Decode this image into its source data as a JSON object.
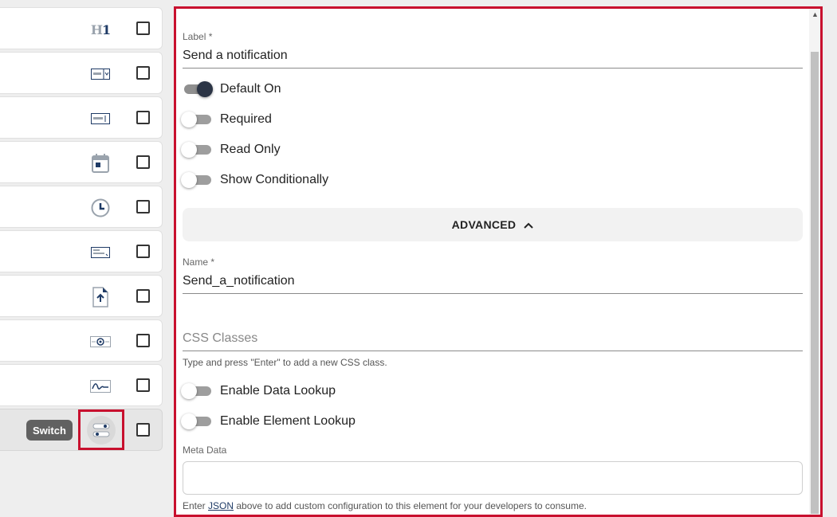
{
  "element_types": [
    {
      "name": "heading",
      "icon": "heading-icon"
    },
    {
      "name": "select",
      "icon": "select-dropdown-icon"
    },
    {
      "name": "text-input",
      "icon": "text-input-icon"
    },
    {
      "name": "date",
      "icon": "calendar-icon"
    },
    {
      "name": "time",
      "icon": "clock-icon"
    },
    {
      "name": "textarea",
      "icon": "textarea-icon"
    },
    {
      "name": "file-upload",
      "icon": "file-upload-icon"
    },
    {
      "name": "email",
      "icon": "email-icon"
    },
    {
      "name": "signature",
      "icon": "signature-icon"
    },
    {
      "name": "switch",
      "icon": "switch-toggle-icon",
      "tooltip": "Switch",
      "active": true
    }
  ],
  "heading_glyph": {
    "h": "H",
    "one": "1"
  },
  "panel": {
    "label": {
      "title": "Label *",
      "value": "Send a notification"
    },
    "toggles": [
      {
        "label": "Default On",
        "on": true
      },
      {
        "label": "Required",
        "on": false
      },
      {
        "label": "Read Only",
        "on": false
      },
      {
        "label": "Show Conditionally",
        "on": false
      }
    ],
    "advanced": {
      "label": "ADVANCED",
      "icon": "chevron-up-icon"
    },
    "name": {
      "title": "Name *",
      "value": "Send_a_notification"
    },
    "css_classes": {
      "placeholder": "CSS Classes",
      "helper": "Type and press \"Enter\" to add a new CSS class."
    },
    "lookup_toggles": [
      {
        "label": "Enable Data Lookup",
        "on": false
      },
      {
        "label": "Enable Element Lookup",
        "on": false
      }
    ],
    "meta": {
      "title": "Meta Data",
      "helper_before": "Enter ",
      "helper_link": "JSON",
      "helper_after": " above to add custom configuration to this element for your developers to consume."
    }
  },
  "colors": {
    "accent_border": "#c8102e",
    "toggle_on_knob": "#2b3445",
    "link": "#1f3b66"
  }
}
